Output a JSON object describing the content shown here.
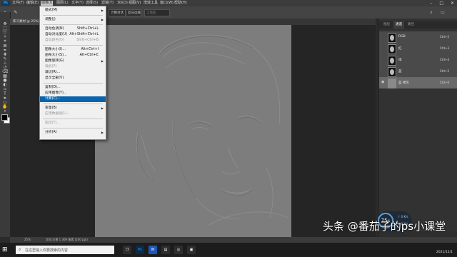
{
  "menubar": {
    "app_logo": "Ps",
    "items": [
      "文件(F)",
      "编辑(E)",
      "图像(I)",
      "图层(L)",
      "文字(Y)",
      "选择(S)",
      "滤镜(T)",
      "3D(D)",
      "视图(V)",
      "增效工具",
      "窗口(W)",
      "帮助(H)"
    ],
    "active_index": 2,
    "window_controls": [
      "–",
      "□",
      "✕"
    ]
  },
  "options_bar": {
    "labels": [
      "计算对话",
      "反向选择",
      "工作区"
    ]
  },
  "document_tab": {
    "title": "练习素材 @ 25%(RGB/8#)"
  },
  "image_menu": {
    "items": [
      {
        "label": "模式(M)",
        "shortcut": "",
        "submenu": true,
        "disabled": false
      },
      {
        "sep": true
      },
      {
        "label": "调整(J)",
        "shortcut": "",
        "submenu": true,
        "disabled": false
      },
      {
        "sep": true
      },
      {
        "label": "自动色调(N)",
        "shortcut": "Shift+Ctrl+L",
        "submenu": false,
        "disabled": false
      },
      {
        "label": "自动对比度(U)",
        "shortcut": "Alt+Shift+Ctrl+L",
        "submenu": false,
        "disabled": false
      },
      {
        "label": "自动颜色(O)",
        "shortcut": "Shift+Ctrl+B",
        "submenu": false,
        "disabled": true
      },
      {
        "sep": true
      },
      {
        "label": "图像大小(I)...",
        "shortcut": "Alt+Ctrl+I",
        "submenu": false,
        "disabled": false
      },
      {
        "label": "画布大小(S)...",
        "shortcut": "Alt+Ctrl+C",
        "submenu": false,
        "disabled": false
      },
      {
        "label": "图像旋转(G)",
        "shortcut": "",
        "submenu": true,
        "disabled": false
      },
      {
        "label": "裁剪(P)",
        "shortcut": "",
        "submenu": false,
        "disabled": true
      },
      {
        "label": "裁切(R)...",
        "shortcut": "",
        "submenu": false,
        "disabled": false
      },
      {
        "label": "显示全部(V)",
        "shortcut": "",
        "submenu": false,
        "disabled": false
      },
      {
        "sep": true
      },
      {
        "label": "复制(D)...",
        "shortcut": "",
        "submenu": false,
        "disabled": false
      },
      {
        "label": "应用图像(Y)...",
        "shortcut": "",
        "submenu": false,
        "disabled": false
      },
      {
        "label": "计算(C)...",
        "shortcut": "",
        "submenu": false,
        "disabled": false,
        "highlight": true
      },
      {
        "sep": true
      },
      {
        "label": "变量(B)",
        "shortcut": "",
        "submenu": true,
        "disabled": false
      },
      {
        "label": "应用数据组(L)...",
        "shortcut": "",
        "submenu": false,
        "disabled": true
      },
      {
        "sep": true
      },
      {
        "label": "陷印(T)...",
        "shortcut": "",
        "submenu": false,
        "disabled": true
      },
      {
        "sep": true
      },
      {
        "label": "分析(A)",
        "shortcut": "",
        "submenu": true,
        "disabled": false
      }
    ]
  },
  "panel": {
    "tabs": [
      "图层",
      "通道",
      "路径"
    ],
    "active_tab": 1,
    "channels": [
      {
        "name": "RGB",
        "shortcut": "Ctrl+2",
        "selected": false,
        "visible": false
      },
      {
        "name": "红",
        "shortcut": "Ctrl+3",
        "selected": false,
        "visible": false
      },
      {
        "name": "绿",
        "shortcut": "Ctrl+4",
        "selected": false,
        "visible": false
      },
      {
        "name": "蓝",
        "shortcut": "Ctrl+5",
        "selected": false,
        "visible": false
      },
      {
        "name": "蓝 拷贝",
        "shortcut": "Ctrl+6",
        "selected": true,
        "visible": true
      }
    ]
  },
  "status_bar": {
    "zoom": "25%",
    "doc_info": "文档:全景 1 369 像素 (240 ppi)"
  },
  "widget": {
    "percent": "75",
    "unit": "%",
    "up": "0",
    "down": "0",
    "up_unit": "K/s",
    "down_unit": "K/s"
  },
  "watermark": "头条 @番茄子的ps小课堂",
  "taskbar": {
    "search_placeholder": "在这里输入你要搜索的内容",
    "apps": [
      "Ps",
      "W"
    ],
    "date": "2021/12/1"
  },
  "colors": {
    "accent": "#0a64ad",
    "canvas": "#7d7d7d"
  }
}
